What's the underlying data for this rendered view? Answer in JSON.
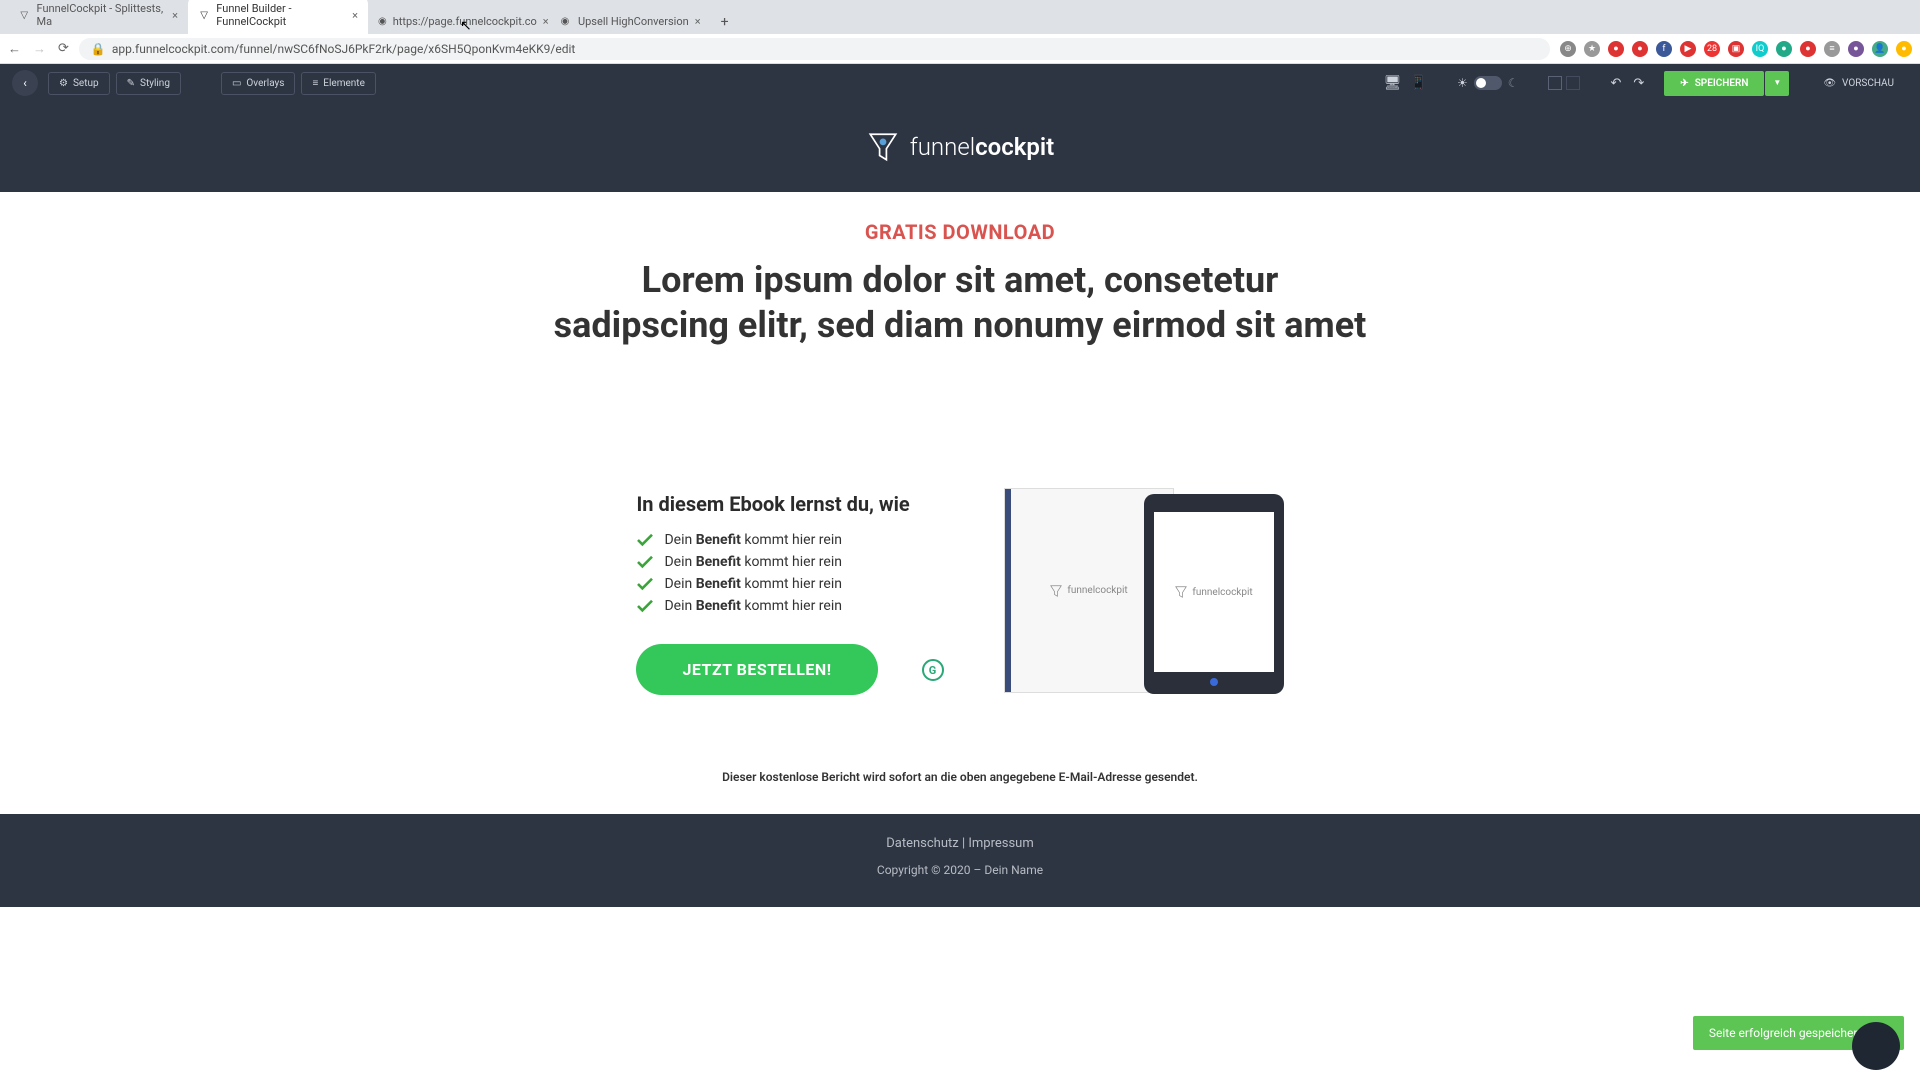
{
  "browser": {
    "tabs": [
      {
        "title": "FunnelCockpit - Splittests, Ma",
        "active": false
      },
      {
        "title": "Funnel Builder - FunnelCockpit",
        "active": true
      },
      {
        "title": "https://page.funnelcockpit.co",
        "active": false
      },
      {
        "title": "Upsell HighConversion",
        "active": false
      }
    ],
    "url": "app.funnelcockpit.com/funnel/nwSC6fNoSJ6PkF2rk/page/x6SH5QponKvm4eKK9/edit"
  },
  "toolbar": {
    "setup": "Setup",
    "styling": "Styling",
    "overlays": "Overlays",
    "elemente": "Elemente",
    "save": "SPEICHERN",
    "preview": "VORSCHAU"
  },
  "page": {
    "brand_light": "funnel",
    "brand_bold": "cockpit",
    "kicker": "GRATIS DOWNLOAD",
    "headline": "Lorem ipsum dolor sit amet, consetetur sadipscing elitr, sed diam nonumy eirmod sit amet",
    "ebook_heading": "In diesem Ebook lernst du, wie",
    "benefits": [
      {
        "pre": "Dein ",
        "bold": "Benefit",
        "post": " kommt hier rein"
      },
      {
        "pre": "Dein ",
        "bold": "Benefit",
        "post": " kommt hier rein"
      },
      {
        "pre": "Dein ",
        "bold": "Benefit",
        "post": " kommt hier rein"
      },
      {
        "pre": "Dein ",
        "bold": "Benefit",
        "post": " kommt hier rein"
      }
    ],
    "cta": "JETZT BESTELLEN!",
    "g_badge": "G",
    "mini_brand": "funnelcockpit",
    "disclaimer": "Dieser kostenlose Bericht wird sofort an die oben angegebene E-Mail-Adresse gesendet.",
    "footer_link1": "Datenschutz",
    "footer_sep": " | ",
    "footer_link2": "Impressum",
    "copyright": "Copyright © 2020 – Dein Name"
  },
  "toast": {
    "message": "Seite erfolgreich gespeichert!",
    "close": "✕"
  },
  "colors": {
    "accent_green": "#5cc553",
    "accent_red": "#d9534f",
    "dark_bg": "#2d3543"
  }
}
